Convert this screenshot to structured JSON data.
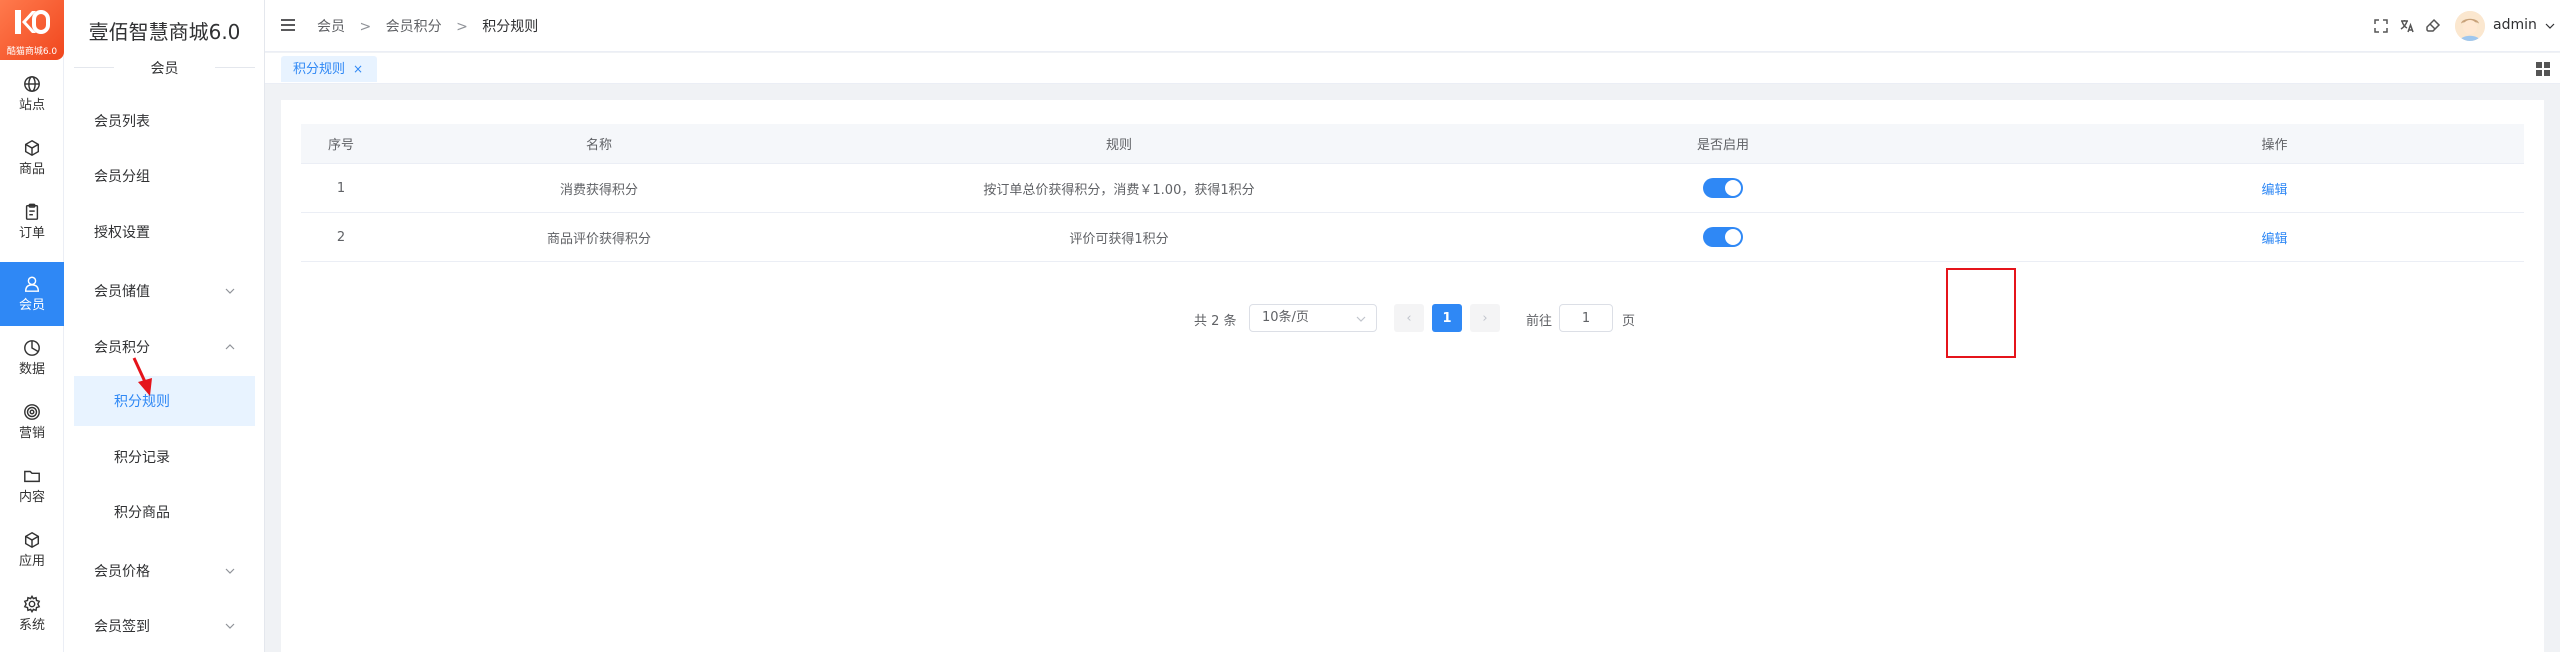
{
  "app": {
    "logo_subtitle": "酷猫商城6.0",
    "brand": "壹佰智慧商城6.0",
    "section_title": "会员"
  },
  "rail": [
    {
      "label": "站点",
      "icon": "globe-icon"
    },
    {
      "label": "商品",
      "icon": "box-icon"
    },
    {
      "label": "订单",
      "icon": "clipboard-icon"
    },
    {
      "label": "会员",
      "icon": "user-icon",
      "active": true
    },
    {
      "label": "数据",
      "icon": "pie-chart-icon"
    },
    {
      "label": "营销",
      "icon": "target-icon"
    },
    {
      "label": "内容",
      "icon": "folder-icon"
    },
    {
      "label": "应用",
      "icon": "cube-icon"
    },
    {
      "label": "系统",
      "icon": "gear-icon"
    }
  ],
  "menu": {
    "member_list": "会员列表",
    "member_group": "会员分组",
    "auth_settings": "授权设置",
    "member_stored_value": "会员储值",
    "member_points": "会员积分",
    "points_rules": "积分规则",
    "points_records": "积分记录",
    "points_goods": "积分商品",
    "member_price": "会员价格",
    "member_signin": "会员签到"
  },
  "header": {
    "breadcrumb": [
      "会员",
      "会员积分",
      "积分规则"
    ],
    "breadcrumb_sep": ">",
    "username": "admin"
  },
  "tabs": [
    {
      "label": "积分规则",
      "close": "×"
    }
  ],
  "table": {
    "columns": [
      "序号",
      "名称",
      "规则",
      "是否启用",
      "操作"
    ],
    "rows": [
      {
        "index": "1",
        "name": "消费获得积分",
        "rule": "按订单总价获得积分，消费￥1.00，获得1积分",
        "enabled": true,
        "action": "编辑"
      },
      {
        "index": "2",
        "name": "商品评价获得积分",
        "rule": "评价可获得1积分",
        "enabled": true,
        "action": "编辑"
      }
    ]
  },
  "pagination": {
    "total_text": "共 2 条",
    "page_size": "10条/页",
    "prev": "‹",
    "current": "1",
    "next": "›",
    "goto_label": "前往",
    "goto_value": "1",
    "page_suffix": "页"
  },
  "colors": {
    "primary": "#2f88f5",
    "logo": "#f0461d",
    "highlight_box": "#e5141b"
  }
}
